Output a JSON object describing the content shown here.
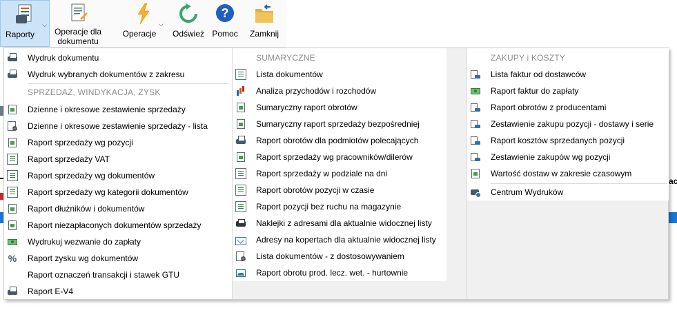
{
  "toolbar": {
    "raporty": "Raporty",
    "operacje_dla_1": "Operacje dla",
    "operacje_dla_2": "dokumentu",
    "operacje": "Operacje",
    "odswiez": "Odśwież",
    "pomoc": "Pomoc",
    "zamknij": "Zamknij"
  },
  "menu": {
    "col1": {
      "top_items": [
        {
          "label": "Wydruk dokumentu",
          "icon": "print-icon"
        },
        {
          "label": "Wydruk wybranych dokumentów z zakresu",
          "icon": "print-icon"
        }
      ],
      "header": "SPRZEDAŻ, WINDYKACJA, ZYSK",
      "items": [
        {
          "label": "Dzienne i okresowe zestawienie sprzedaży",
          "icon": "document-icon"
        },
        {
          "label": "Dzienne i okresowe zestawienie sprzedaży - lista",
          "icon": "document-gear-icon"
        },
        {
          "label": "Raport sprzedaży wg pozycji",
          "icon": "document-icon"
        },
        {
          "label": "Raport sprzedaży VAT",
          "icon": "document-icon"
        },
        {
          "label": "Raport sprzedaży wg dokumentów",
          "icon": "document-icon"
        },
        {
          "label": "Raport sprzedaży wg kategorii dokumentów",
          "icon": "document-icon"
        },
        {
          "label": "Raport dłużników i dokumentów",
          "icon": "document-icon"
        },
        {
          "label": "Raport niezapłaconych dokumentów sprzedaży",
          "icon": "document-icon"
        },
        {
          "label": "Wydrukuj wezwanie do zapłaty",
          "icon": "money-icon"
        },
        {
          "label": "Raport zysku wg dokumentów",
          "icon": "percent-icon"
        },
        {
          "label": "Raport oznaczeń transakcji i stawek GTU",
          "icon": ""
        },
        {
          "label": "Raport E-V4",
          "icon": "print-icon"
        }
      ]
    },
    "col2": {
      "header": "SUMARYCZNE",
      "items": [
        {
          "label": "Lista dokumentów",
          "icon": "document-list-icon"
        },
        {
          "label": "Analiza przychodów i rozchodów",
          "icon": "bar-chart-icon"
        },
        {
          "label": "Sumaryczny raport obrotów",
          "icon": "money-document-icon"
        },
        {
          "label": "Sumaryczny raport sprzedaży bezpośredniej",
          "icon": "money-document-icon"
        },
        {
          "label": "Raport obrotów dla podmiotów polecających",
          "icon": "print-icon"
        },
        {
          "label": "Raport sprzedaży wg pracowników/dilerów",
          "icon": "money-document-icon"
        },
        {
          "label": "Raport sprzedaży w podziale na dni",
          "icon": "document-icon"
        },
        {
          "label": "Raport obrotów pozycji w czasie",
          "icon": "document-icon"
        },
        {
          "label": "Raport pozycji bez ruchu na magazynie",
          "icon": "document-icon"
        },
        {
          "label": "Naklejki z adresami dla aktualnie widocznej listy",
          "icon": "label-printer-icon"
        },
        {
          "label": "Adresy na kopertach dla aktualnie widocznej listy",
          "icon": "envelope-icon"
        },
        {
          "label": "Lista dokumentów -  z dostosowywaniem",
          "icon": "document-gear-icon"
        },
        {
          "label": "Raport obrotu prod. lecz. wet.  - hurtownie",
          "icon": "chart-document-icon"
        }
      ]
    },
    "col3": {
      "header": "ZAKUPY i KOSZTY",
      "items": [
        {
          "label": "Lista faktur od dostawców",
          "icon": "truck-document-icon"
        },
        {
          "label": "Raport faktur do zapłaty",
          "icon": "money-icon"
        },
        {
          "label": "Raport obrotów z producentami",
          "icon": "truck-document-icon"
        },
        {
          "label": "Zestawienie zakupu pozycji - dostawy i serie",
          "icon": "truck-document-icon"
        },
        {
          "label": "Raport kosztów sprzedanych pozycji",
          "icon": "truck-document-icon"
        },
        {
          "label": "Zestawienie zakupów wg pozycji",
          "icon": "truck-document-icon"
        },
        {
          "label": "Wartość dostaw w zakresie czasowym",
          "icon": "money-document-icon"
        }
      ],
      "bottom_item": {
        "label": "Centrum Wydruków",
        "icon": "print-globe-icon"
      }
    }
  }
}
